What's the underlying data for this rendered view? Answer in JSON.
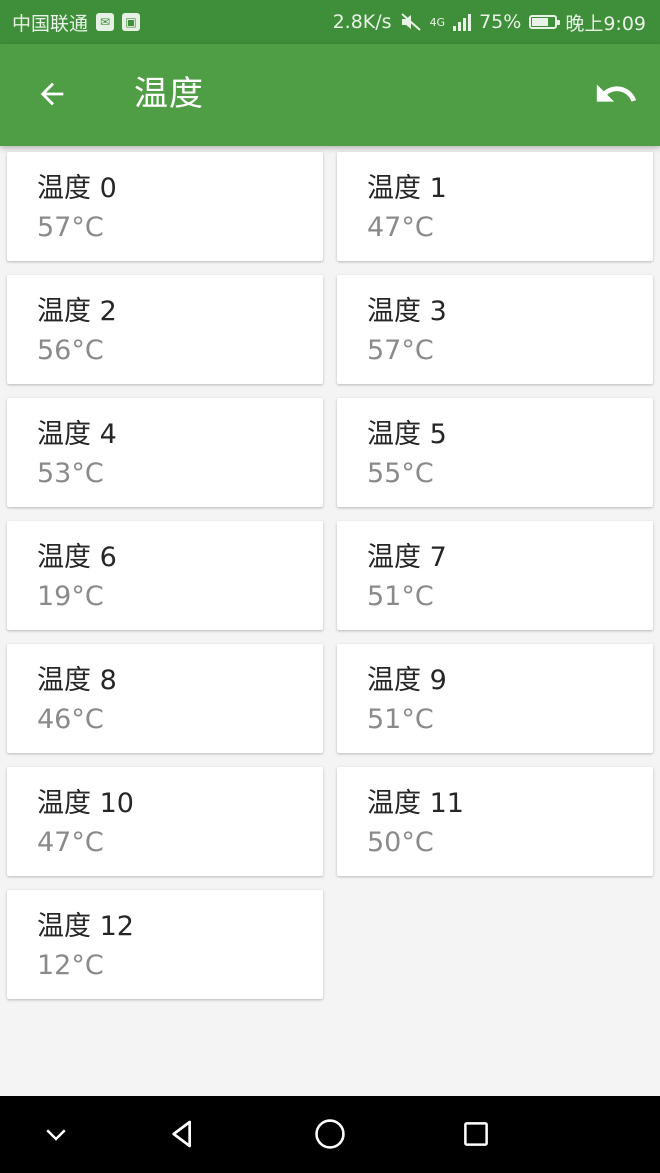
{
  "status_bar": {
    "carrier": "中国联通",
    "speed": "2.8K/s",
    "network_type": "4G",
    "battery": "75%",
    "battery_level": 0.75,
    "time": "晚上9:09"
  },
  "app_bar": {
    "title": "温度",
    "back_icon": "arrow-left-icon",
    "undo_icon": "undo-icon"
  },
  "sensors": [
    {
      "label": "温度 0",
      "value": "57°C"
    },
    {
      "label": "温度 1",
      "value": "47°C"
    },
    {
      "label": "温度 2",
      "value": "56°C"
    },
    {
      "label": "温度 3",
      "value": "57°C"
    },
    {
      "label": "温度 4",
      "value": "53°C"
    },
    {
      "label": "温度 5",
      "value": "55°C"
    },
    {
      "label": "温度 6",
      "value": "19°C"
    },
    {
      "label": "温度 7",
      "value": "51°C"
    },
    {
      "label": "温度 8",
      "value": "46°C"
    },
    {
      "label": "温度 9",
      "value": "51°C"
    },
    {
      "label": "温度 10",
      "value": "47°C"
    },
    {
      "label": "温度 11",
      "value": "50°C"
    },
    {
      "label": "温度 12",
      "value": "12°C"
    }
  ],
  "colors": {
    "status_bar": "#3f8f3a",
    "app_bar": "#4f9e45",
    "background": "#f4f4f4",
    "card_title": "#262626",
    "card_value": "#8a8a8a"
  }
}
